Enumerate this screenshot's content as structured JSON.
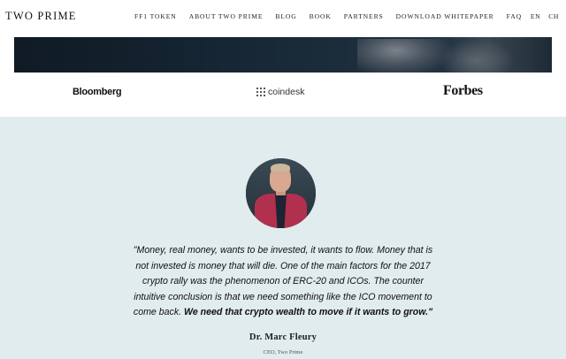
{
  "header": {
    "brand": "TWO PRIME",
    "nav": [
      {
        "label": "FF1 TOKEN"
      },
      {
        "label": "ABOUT TWO PRIME"
      },
      {
        "label": "BLOG"
      },
      {
        "label": "BOOK"
      },
      {
        "label": "PARTNERS"
      },
      {
        "label": "DOWNLOAD WHITEPAPER"
      },
      {
        "label": "FAQ"
      }
    ],
    "languages": [
      "EN",
      "CH"
    ]
  },
  "press": {
    "logos": [
      "Bloomberg",
      "coindesk",
      "Forbes"
    ]
  },
  "testimonial": {
    "quote_regular": "\"Money, real money, wants to be invested, it wants to flow. Money that is not invested is money that will die. One of the main factors for the 2017 crypto rally was the phenomenon of ERC-20 and ICOs. The counter intuitive conclusion is that we need something like the ICO movement to come back.",
    "quote_bold": "We need that crypto wealth to move if it wants to grow.\"",
    "author_name": "Dr. Marc Fleury",
    "author_role": "CEO, Two Prime"
  },
  "colors": {
    "testimonial_bg": "#e1ecee",
    "hero_dark": "#162634",
    "text": "#111111"
  }
}
